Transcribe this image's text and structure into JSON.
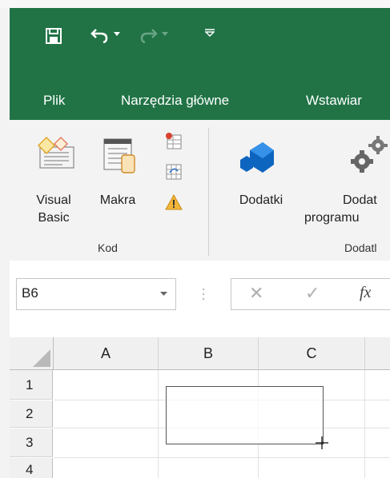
{
  "quick_access": {
    "icons": [
      "save-icon",
      "undo-icon",
      "redo-icon",
      "customize-qat-icon"
    ]
  },
  "tabs": [
    {
      "label": "Plik"
    },
    {
      "label": "Narzędzia główne"
    },
    {
      "label": "Wstawiar"
    }
  ],
  "ribbon": {
    "code_group": {
      "visual_basic_label": "Visual Basic",
      "visual_basic_line1": "Visual",
      "visual_basic_line2": "Basic",
      "macros_label": "Makra",
      "group_label": "Kod"
    },
    "addins_group": {
      "addins_label": "Dodatki",
      "program_addins_line1": "Dodat",
      "program_addins_line2": "programu",
      "group_label": "Dodatl"
    }
  },
  "formula_bar": {
    "name_box_value": "B6",
    "cancel_symbol": "✕",
    "enter_symbol": "✓",
    "fx_label": "fx",
    "formula_value": ""
  },
  "grid": {
    "columns": [
      "A",
      "B",
      "C"
    ],
    "rows": [
      "1",
      "2",
      "3",
      "4"
    ]
  },
  "colors": {
    "excel_green": "#217346",
    "ribbon_bg": "#f3f3f3"
  }
}
